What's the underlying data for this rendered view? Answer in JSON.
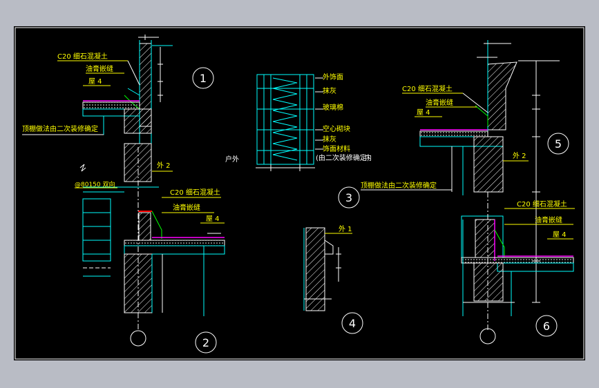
{
  "details": {
    "d1": "1",
    "d2": "2",
    "d3": "3",
    "d4": "4",
    "d5": "5",
    "d6": "6"
  },
  "labels": {
    "c20_left": "C20 细石混凝土",
    "seal_left": "油膏嵌缝",
    "roof4_left": "屋 4",
    "ceiling_left": "顶棚做法由二次装修确定",
    "ext2_left": "外 2",
    "band150": "@80150 双向",
    "c20_left2": "C20 细石混凝土",
    "seal_left2": "油膏嵌缝",
    "roof4_left2": "屋 4",
    "exterior_side": "户外",
    "wall_finish": "外饰面",
    "plaster1": "抹灰",
    "glass_wool": "玻璃棉",
    "hollow_block": "空心砌块",
    "plaster2": "抹灰",
    "finish_material": "饰面材料",
    "by_decoration": "(由二次装修确定)",
    "interior_side": "内",
    "ext1": "外 1",
    "c20_right": "C20 细石混凝土",
    "seal_right": "油膏嵌缝",
    "roof4_right": "屋 4",
    "ceiling_right": "顶棚做法由二次装修确定",
    "ext2_right": "外 2",
    "c20_right2": "C20 细石混凝土",
    "seal_right2": "油膏嵌缝",
    "roof4_right2": "屋 4"
  },
  "colors": {
    "background": "#000000",
    "window_bg": "#b9bcc5",
    "cyan": "#00ffff",
    "yellow": "#ffff00",
    "white": "#ffffff",
    "green": "#00ff00",
    "red": "#ff0000",
    "magenta": "#ff00ff"
  }
}
